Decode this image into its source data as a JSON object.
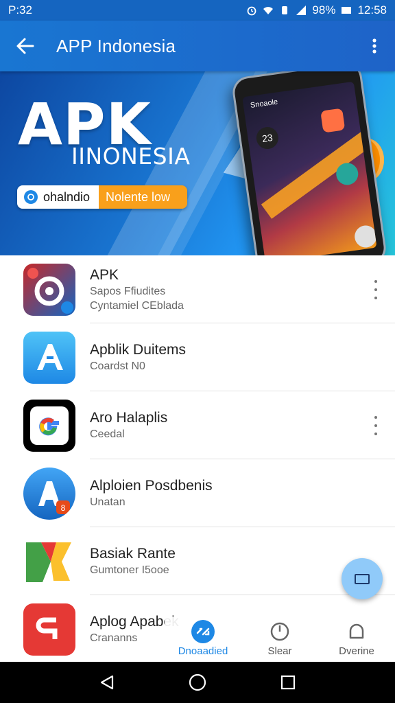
{
  "status_bar": {
    "time_left": "P:32",
    "battery": "98%",
    "clock": "12:58"
  },
  "app_bar": {
    "title": "APP Indonesia",
    "back_icon": "back-arrow-icon",
    "more_icon": "more-vert-icon"
  },
  "banner": {
    "headline": "APK",
    "subline": "IINONESIA",
    "pill_left": "ohalndio",
    "pill_right": "Nolente low",
    "phone_screen_label": "Snoaole",
    "phone_badge": "23"
  },
  "apps": [
    {
      "name": "APK",
      "sub1": "Sapos Ffiudites",
      "sub2": "Cyntamiel CEblada",
      "has_more": true,
      "colors": [
        "#c62828",
        "#1565c0"
      ]
    },
    {
      "name": "Apblik Duitems",
      "sub1": "Coardst  N0",
      "sub2": "",
      "has_more": false,
      "colors": [
        "#29b6f6",
        "#1565c0"
      ]
    },
    {
      "name": "Aro Halaplis",
      "sub1": "Ceedal",
      "sub2": "",
      "has_more": true,
      "colors": [
        "#000000",
        "#ffffff"
      ]
    },
    {
      "name": "Alploien Posdbenis",
      "sub1": "Unatan",
      "sub2": "",
      "has_more": false,
      "colors": [
        "#1e88e5",
        "#0d47a1"
      ]
    },
    {
      "name": "Basiak Rante",
      "sub1": "Gumtoner  I5ooe",
      "sub2": "",
      "has_more": false,
      "colors": [
        "#43a047",
        "#fbc02d"
      ]
    },
    {
      "name": "Aplog Apabek",
      "sub1": "Crananns",
      "sub2": "",
      "has_more": false,
      "colors": [
        "#e53935",
        "#ffffff"
      ]
    }
  ],
  "fab": {
    "icon": "window-icon"
  },
  "bottom_nav": [
    {
      "label": "Dnoaadied",
      "icon": "download-icon",
      "active": true
    },
    {
      "label": "Slear",
      "icon": "search-icon",
      "active": false
    },
    {
      "label": "Dverine",
      "icon": "bell-icon",
      "active": false
    }
  ],
  "system_nav": {
    "back": "back-triangle-icon",
    "home": "home-circle-icon",
    "recents": "recents-square-icon"
  }
}
